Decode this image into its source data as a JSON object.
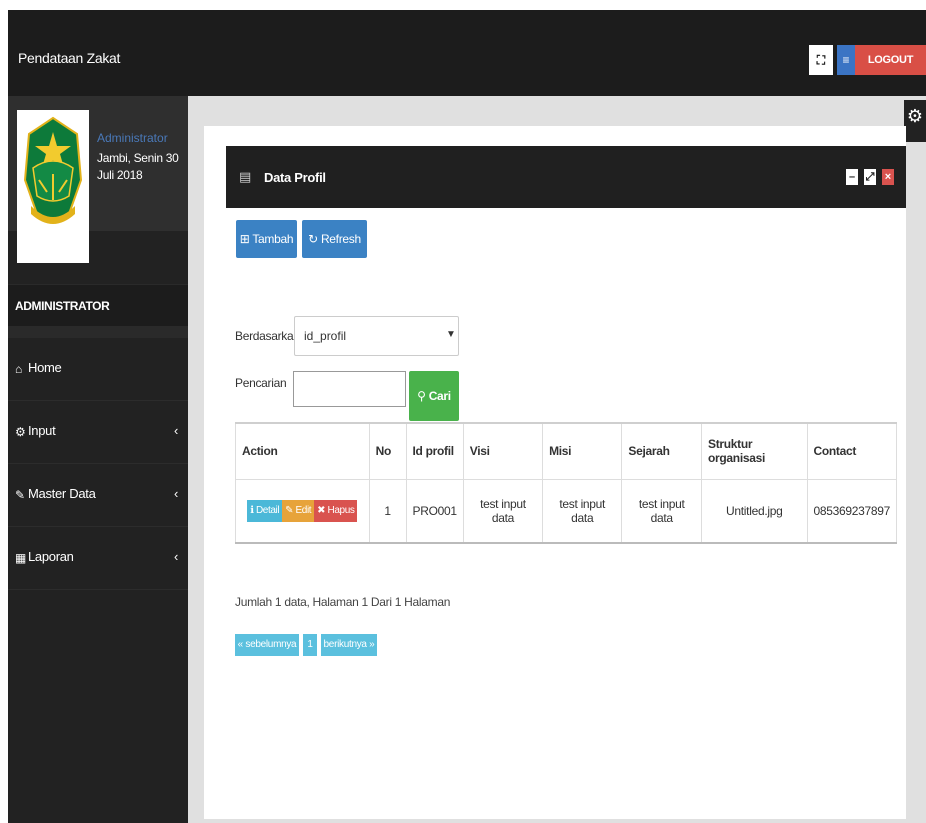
{
  "app": {
    "title": "Pendataan Zakat"
  },
  "topbar": {
    "expand_glyph": "⛶",
    "menu_glyph": "≡",
    "logout_label": "LOGOUT"
  },
  "user": {
    "name": "Administrator",
    "date": "Jambi, Senin 30 Juli 2018"
  },
  "sidebar": {
    "role": "ADMINISTRATOR",
    "items": [
      {
        "label": "Home",
        "icon": "home-icon",
        "glyph": "⌂",
        "has_chevron": false
      },
      {
        "label": "Input",
        "icon": "cogs-icon",
        "glyph": "⚙",
        "has_chevron": true
      },
      {
        "label": "Master Data",
        "icon": "edit-icon",
        "glyph": "✎",
        "has_chevron": true
      },
      {
        "label": "Laporan",
        "icon": "calendar-icon",
        "glyph": "▦",
        "has_chevron": true
      }
    ],
    "chevron": "‹"
  },
  "panel": {
    "title": "Data Profil",
    "add_label": "Tambah",
    "refresh_label": "Refresh"
  },
  "filter": {
    "by_label": "Berdasarkan:",
    "by_value": "id_profil",
    "search_label": "Pencarian   :",
    "search_value": "",
    "search_button": "Cari"
  },
  "table": {
    "headers": [
      "Action",
      "No",
      "Id profil",
      "Visi",
      "Misi",
      "Sejarah",
      "Struktur organisasi",
      "Contact"
    ],
    "rows": [
      {
        "actions": {
          "detail": "Detail",
          "edit": "Edit",
          "hapus": "Hapus"
        },
        "no": "1",
        "id_profil": "PRO001",
        "visi": "test input data",
        "misi": "test input data",
        "sejarah": "test input data",
        "struktur": "Untitled.jpg",
        "contact": "085369237897"
      }
    ]
  },
  "summary": "Jumlah 1 data, Halaman 1 Dari 1 Halaman",
  "pagination": {
    "prev": "« sebelumnya",
    "current": "1",
    "next": "berikutnya »"
  },
  "colors": {
    "topbar": "#1c1c1c",
    "sidebar": "#222222",
    "primary": "#3b82c4",
    "success": "#49b24b",
    "danger": "#d9534f",
    "info": "#5bc0de",
    "warning": "#e7a33a"
  }
}
